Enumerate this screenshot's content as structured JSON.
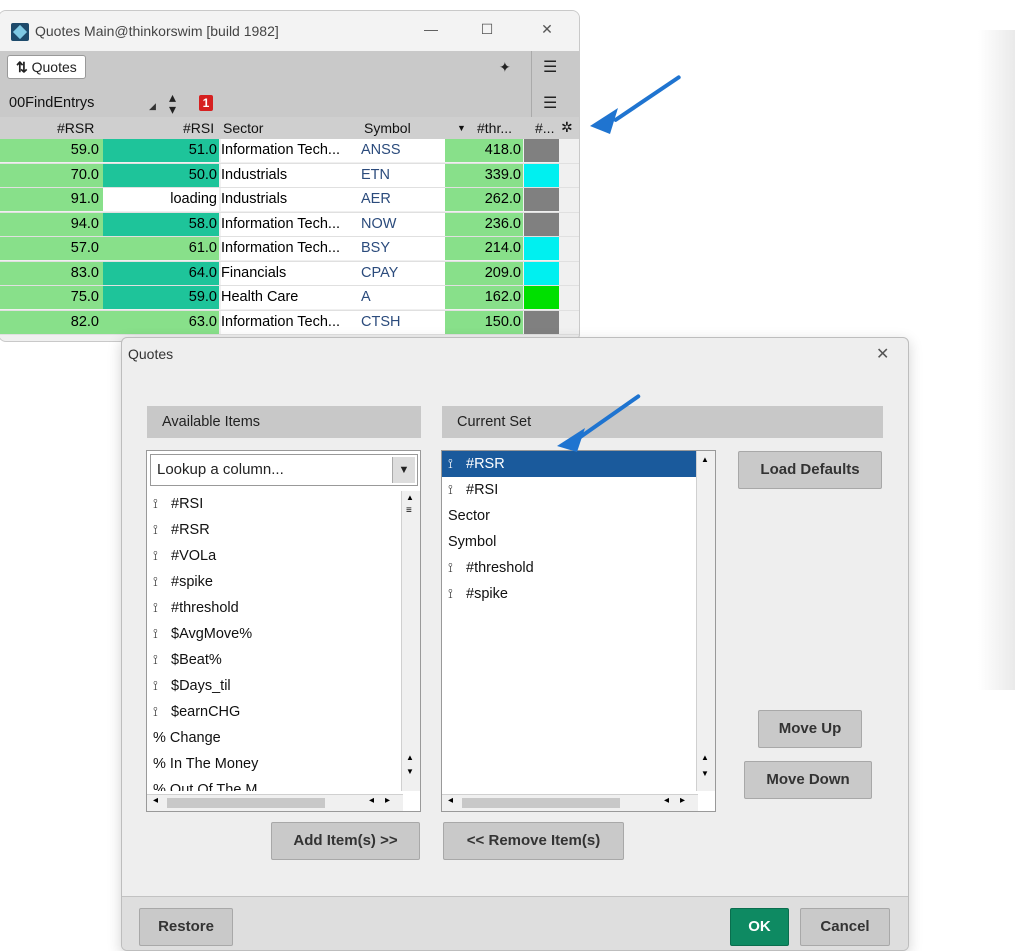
{
  "background_window": {
    "title": "Quotes Main@thinkorswim [build 1982]",
    "quotes_button": "Quotes",
    "watchlist_name": "00FindEntrys",
    "alert_badge": "1",
    "columns": [
      "#RSR",
      "#RSI",
      "Sector",
      "Symbol",
      "#thr...",
      "#..."
    ],
    "rows": [
      {
        "rsr": "59.0",
        "rsi": "51.0",
        "sector": "Information Tech...",
        "symbol": "ANSS",
        "threshold": "418.0",
        "spike_color": "#808080",
        "rsi_color": "#1ec49a"
      },
      {
        "rsr": "70.0",
        "rsi": "50.0",
        "sector": "Industrials",
        "symbol": "ETN",
        "threshold": "339.0",
        "spike_color": "#00f0f0",
        "rsi_color": "#1ec49a"
      },
      {
        "rsr": "91.0",
        "rsi": "loading",
        "sector": "Industrials",
        "symbol": "AER",
        "threshold": "262.0",
        "spike_color": "#808080",
        "rsi_color": "#ffffff"
      },
      {
        "rsr": "94.0",
        "rsi": "58.0",
        "sector": "Information Tech...",
        "symbol": "NOW",
        "threshold": "236.0",
        "spike_color": "#808080",
        "rsi_color": "#1ec49a"
      },
      {
        "rsr": "57.0",
        "rsi": "61.0",
        "sector": "Information Tech...",
        "symbol": "BSY",
        "threshold": "214.0",
        "spike_color": "#00f0f0",
        "rsi_color": "#88e08a"
      },
      {
        "rsr": "83.0",
        "rsi": "64.0",
        "sector": "Financials",
        "symbol": "CPAY",
        "threshold": "209.0",
        "spike_color": "#00f0f0",
        "rsi_color": "#1ec49a"
      },
      {
        "rsr": "75.0",
        "rsi": "59.0",
        "sector": "Health Care",
        "symbol": "A",
        "threshold": "162.0",
        "spike_color": "#00e000",
        "rsi_color": "#1ec49a"
      },
      {
        "rsr": "82.0",
        "rsi": "63.0",
        "sector": "Information Tech...",
        "symbol": "CTSH",
        "threshold": "150.0",
        "spike_color": "#808080",
        "rsi_color": "#88e08a"
      }
    ]
  },
  "dialog": {
    "title": "Quotes",
    "available_header": "Available Items",
    "current_header": "Current Set",
    "lookup_placeholder": "Lookup a column...",
    "available_items": [
      {
        "label": "#RSI",
        "study": true
      },
      {
        "label": "#RSR",
        "study": true
      },
      {
        "label": "#VOLa",
        "study": true
      },
      {
        "label": "#spike",
        "study": true
      },
      {
        "label": "#threshold",
        "study": true
      },
      {
        "label": "$AvgMove%",
        "study": true
      },
      {
        "label": "$Beat%",
        "study": true
      },
      {
        "label": "$Days_til",
        "study": true
      },
      {
        "label": "$earnCHG",
        "study": true
      },
      {
        "label": "% Change",
        "study": false
      },
      {
        "label": "% In The Money",
        "study": false
      },
      {
        "label": "% Out Of The M...",
        "study": false
      }
    ],
    "current_items": [
      {
        "label": "#RSR",
        "study": true,
        "selected": true
      },
      {
        "label": "#RSI",
        "study": true,
        "selected": false
      },
      {
        "label": "Sector",
        "study": false,
        "selected": false
      },
      {
        "label": "Symbol",
        "study": false,
        "selected": false
      },
      {
        "label": "#threshold",
        "study": true,
        "selected": false
      },
      {
        "label": "#spike",
        "study": true,
        "selected": false
      }
    ],
    "buttons": {
      "load_defaults": "Load Defaults",
      "move_up": "Move Up",
      "move_down": "Move Down",
      "add_items": "Add Item(s) >>",
      "remove_items": "<< Remove Item(s)",
      "restore": "Restore",
      "ok": "OK",
      "cancel": "Cancel"
    }
  },
  "colors": {
    "green_cell": "#88e08a",
    "teal_cell": "#1ec49a",
    "selection_blue": "#1a5a9c",
    "ok_button": "#0e8a62",
    "annotation_arrow": "#1f74d0"
  }
}
